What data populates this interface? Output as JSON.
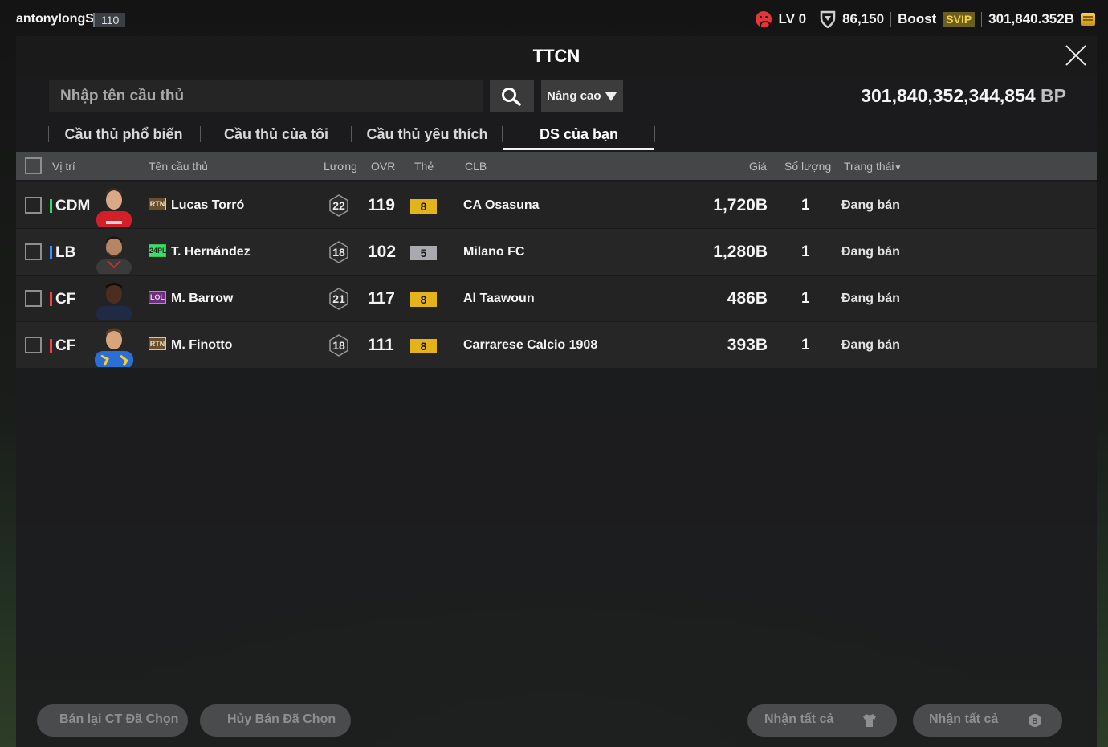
{
  "topbar": {
    "username": "antonylongS",
    "level": "110",
    "lv": "LV 0",
    "points": "86,150",
    "boost_label": "Boost",
    "svip_label": "SVIP",
    "coins": "301,840.352B"
  },
  "panel": {
    "title": "TTCN",
    "search_placeholder": "Nhập tên cầu thủ",
    "advanced_label": "Nâng cao",
    "balance_value": "301,840,352,344,854",
    "balance_unit": "BP"
  },
  "tabs": [
    {
      "label": "Cầu thủ phổ biến",
      "active": false
    },
    {
      "label": "Cầu thủ của tôi",
      "active": false
    },
    {
      "label": "Cầu thủ yêu thích",
      "active": false
    },
    {
      "label": "DS của bạn",
      "active": true
    }
  ],
  "columns": {
    "position": "Vị trí",
    "name": "Tên cầu thủ",
    "salary": "Lương",
    "ovr": "OVR",
    "card": "Thẻ",
    "club": "CLB",
    "price": "Giá",
    "qty": "Số lượng",
    "status": "Trạng thái"
  },
  "rows": [
    {
      "position": "CDM",
      "season": "RTN",
      "name": "Lucas Torró",
      "salary": "22",
      "ovr": "119",
      "grade": "8",
      "club": "CA Osasuna",
      "price": "1,720B",
      "qty": "1",
      "status": "Đang bán"
    },
    {
      "position": "LB",
      "season": "24PL",
      "name": "T. Hernández",
      "salary": "18",
      "ovr": "102",
      "grade": "5",
      "club": "Milano FC",
      "price": "1,280B",
      "qty": "1",
      "status": "Đang bán"
    },
    {
      "position": "CF",
      "season": "LOL",
      "name": "M. Barrow",
      "salary": "21",
      "ovr": "117",
      "grade": "8",
      "club": "Al Taawoun",
      "price": "486B",
      "qty": "1",
      "status": "Đang bán"
    },
    {
      "position": "CF",
      "season": "RTN",
      "name": "M. Finotto",
      "salary": "18",
      "ovr": "111",
      "grade": "8",
      "club": "Carrarese Calcio 1908",
      "price": "393B",
      "qty": "1",
      "status": "Đang bán"
    }
  ],
  "footer": {
    "resell_label": "Bán lại CT Đã Chọn",
    "cancel_label": "Hủy Bán Đã Chọn",
    "claim_all_label_1": "Nhận tất cả",
    "claim_all_label_2": "Nhận tất cả"
  },
  "colors": {
    "accent_gold": "#e4b21a",
    "position_mid": "#2fdc6a",
    "position_def": "#3b90ff",
    "position_att": "#f0434d"
  }
}
